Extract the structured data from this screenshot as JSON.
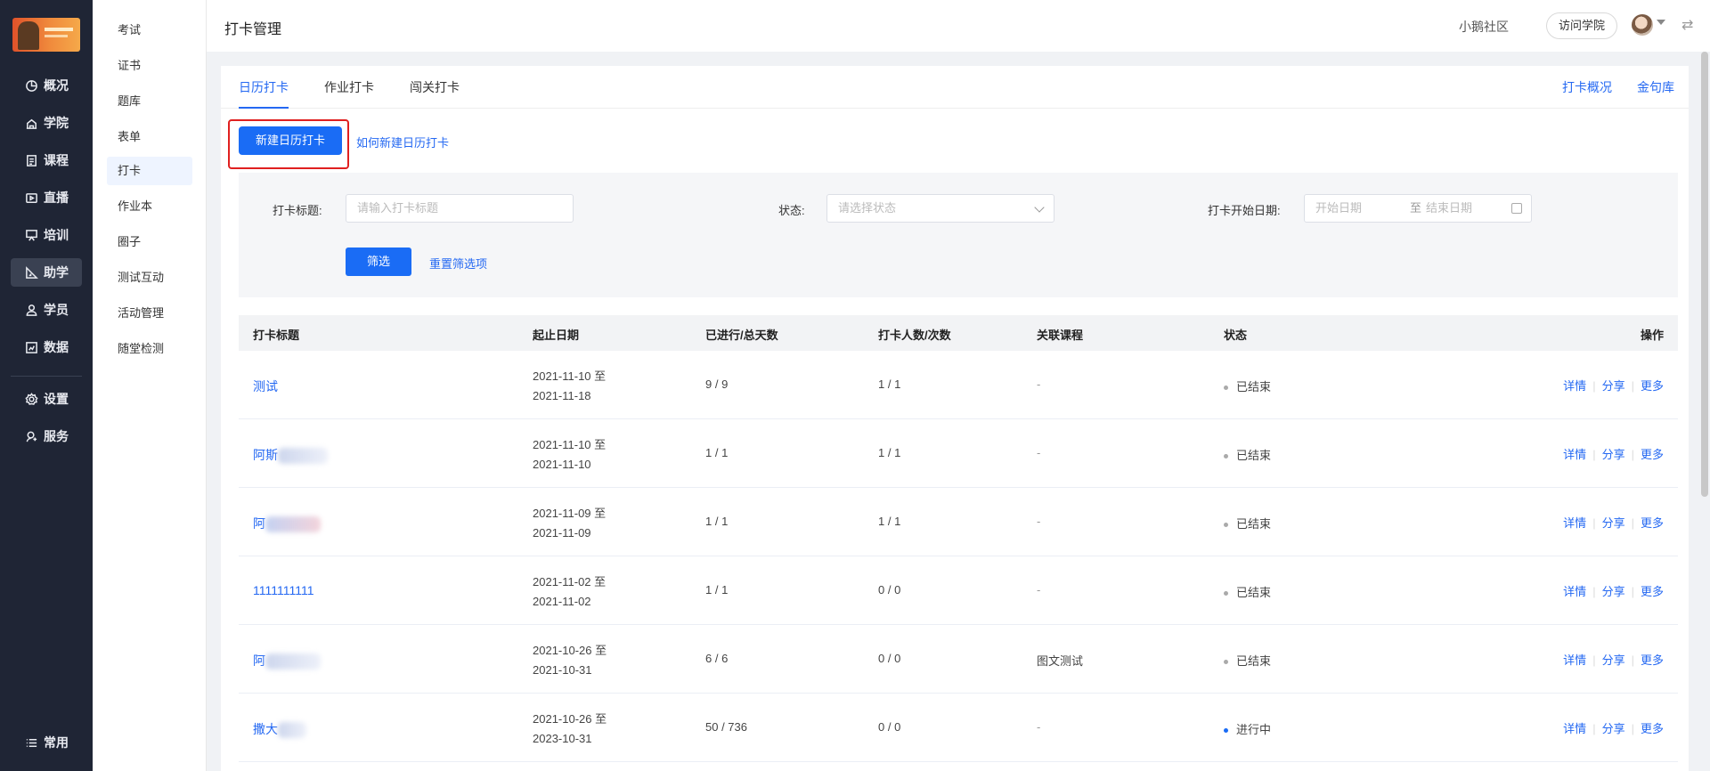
{
  "header": {
    "title": "打卡管理",
    "community": "小鹅社区",
    "visit_button": "访问学院",
    "swap_symbol": "⇄"
  },
  "sidebar": {
    "items": [
      {
        "label": "概况",
        "icon": "pie-chart-icon"
      },
      {
        "label": "学院",
        "icon": "school-icon"
      },
      {
        "label": "课程",
        "icon": "document-icon"
      },
      {
        "label": "直播",
        "icon": "live-icon"
      },
      {
        "label": "培训",
        "icon": "training-icon"
      },
      {
        "label": "助学",
        "icon": "ruler-icon",
        "active": true
      },
      {
        "label": "学员",
        "icon": "user-icon"
      },
      {
        "label": "数据",
        "icon": "data-icon"
      },
      {
        "label": "设置",
        "icon": "gear-icon"
      },
      {
        "label": "服务",
        "icon": "service-icon"
      }
    ],
    "bottom": {
      "label": "常用",
      "icon": "menu-icon"
    }
  },
  "subnav": {
    "items": [
      "考试",
      "证书",
      "题库",
      "表单",
      "打卡",
      "作业本",
      "圈子",
      "测试互动",
      "活动管理",
      "随堂检测"
    ],
    "active": "打卡"
  },
  "tabs": {
    "left": [
      "日历打卡",
      "作业打卡",
      "闯关打卡"
    ],
    "active": "日历打卡",
    "right": [
      "打卡概况",
      "金句库"
    ]
  },
  "actions": {
    "new_button": "新建日历打卡",
    "help_link": "如何新建日历打卡"
  },
  "filters": {
    "title_label": "打卡标题:",
    "title_placeholder": "请输入打卡标题",
    "status_label": "状态:",
    "status_placeholder": "请选择状态",
    "date_label": "打卡开始日期:",
    "date_start_placeholder": "开始日期",
    "date_sep": "至",
    "date_end_placeholder": "结束日期",
    "filter_button": "筛选",
    "reset_link": "重置筛选项"
  },
  "table": {
    "columns": [
      "打卡标题",
      "起止日期",
      "已进行/总天数",
      "打卡人数/次数",
      "关联课程",
      "状态",
      "操作"
    ],
    "op_labels": [
      "详情",
      "分享",
      "更多"
    ],
    "rows": [
      {
        "title": "测试",
        "start": "2021-11-10 至",
        "end": "2021-11-18",
        "progress": "9 / 9",
        "count": "1 / 1",
        "course": "-",
        "status": "已结束",
        "running": false
      },
      {
        "title": "阿斯",
        "start": "2021-11-10 至",
        "end": "2021-11-10",
        "progress": "1 / 1",
        "count": "1 / 1",
        "course": "-",
        "status": "已结束",
        "running": false
      },
      {
        "title": "阿",
        "start": "2021-11-09 至",
        "end": "2021-11-09",
        "progress": "1 / 1",
        "count": "1 / 1",
        "course": "-",
        "status": "已结束",
        "running": false
      },
      {
        "title": "1111111111",
        "start": "2021-11-02 至",
        "end": "2021-11-02",
        "progress": "1 / 1",
        "count": "0 / 0",
        "course": "-",
        "status": "已结束",
        "running": false
      },
      {
        "title": "阿",
        "start": "2021-10-26 至",
        "end": "2021-10-31",
        "progress": "6 / 6",
        "count": "0 / 0",
        "course": "图文测试",
        "status": "已结束",
        "running": false
      },
      {
        "title": "撒大",
        "start": "2021-10-26 至",
        "end": "2023-10-31",
        "progress": "50 / 736",
        "count": "0 / 0",
        "course": "-",
        "status": "进行中",
        "running": true
      }
    ]
  },
  "colors": {
    "accent": "#1a6cf5",
    "sidebar_bg": "#1f2535",
    "highlight": "#e02020"
  }
}
